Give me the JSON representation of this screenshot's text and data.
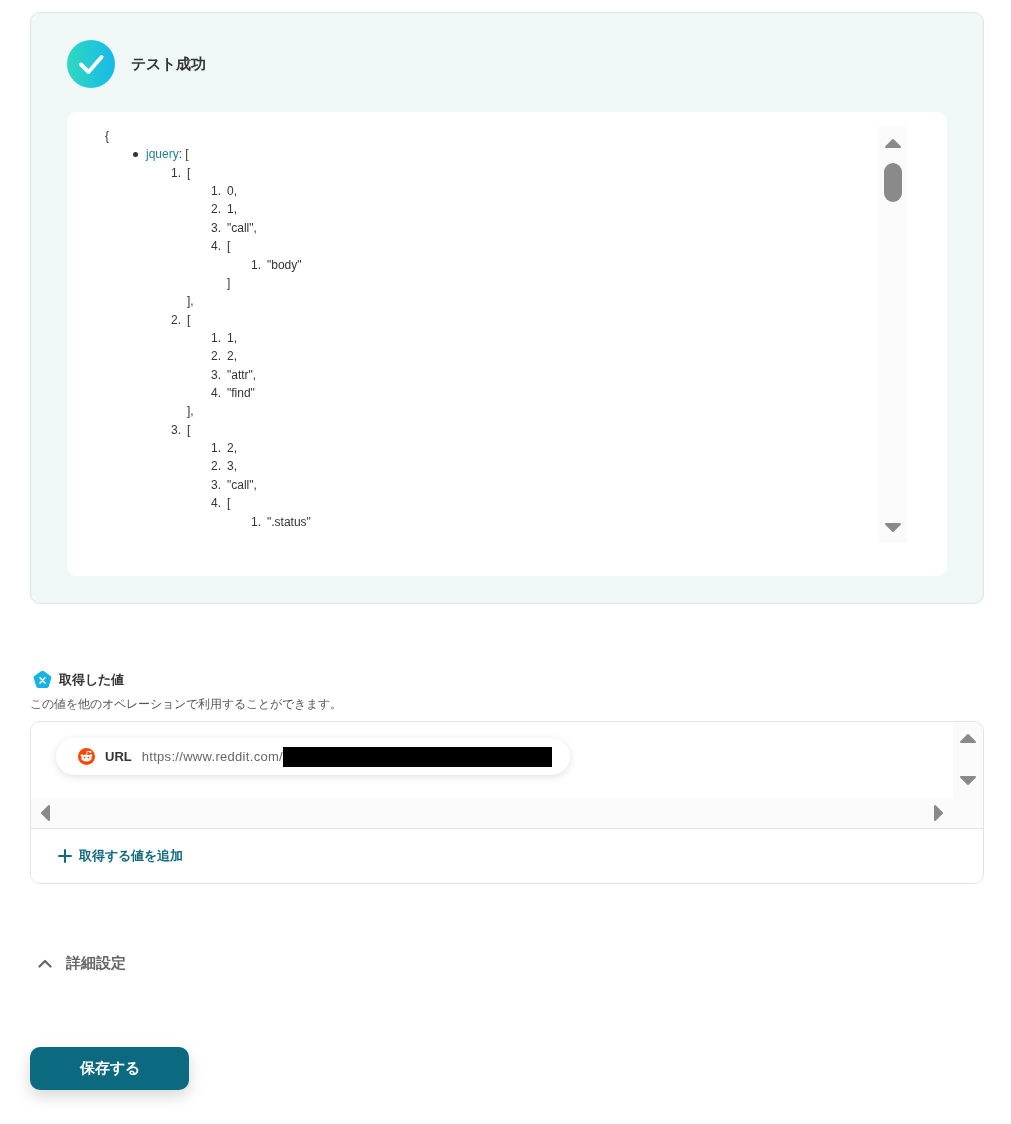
{
  "status_panel": {
    "title": "テスト成功",
    "output": {
      "open": "{",
      "properties": [
        {
          "key": "jquery",
          "after_key": ": [",
          "items": [
            {
              "marker": "1.",
              "text": "[",
              "children": [
                {
                  "marker": "1.",
                  "text": "0,"
                },
                {
                  "marker": "2.",
                  "text": "1,"
                },
                {
                  "marker": "3.",
                  "text": "\"call\","
                },
                {
                  "marker": "4.",
                  "text": "[",
                  "children": [
                    {
                      "marker": "1.",
                      "text": "\"body\""
                    }
                  ],
                  "close": "]"
                }
              ],
              "close": "],"
            },
            {
              "marker": "2.",
              "text": "[",
              "children": [
                {
                  "marker": "1.",
                  "text": "1,"
                },
                {
                  "marker": "2.",
                  "text": "2,"
                },
                {
                  "marker": "3.",
                  "text": "\"attr\","
                },
                {
                  "marker": "4.",
                  "text": "\"find\""
                }
              ],
              "close": "],"
            },
            {
              "marker": "3.",
              "text": "[",
              "children": [
                {
                  "marker": "1.",
                  "text": "2,"
                },
                {
                  "marker": "2.",
                  "text": "3,"
                },
                {
                  "marker": "3.",
                  "text": "\"call\","
                },
                {
                  "marker": "4.",
                  "text": "[",
                  "children": [
                    {
                      "marker": "1.",
                      "text": "\".status\""
                    }
                  ]
                }
              ]
            }
          ]
        }
      ]
    }
  },
  "obtained_values": {
    "title": "取得した値",
    "description": "この値を他のオペレーションで利用することができます。",
    "values": [
      {
        "label": "URL",
        "value": "https://www.reddit.com/"
      }
    ],
    "add_button": "取得する値を追加"
  },
  "advanced_settings": {
    "label": "詳細設定"
  },
  "save_button": "保存する"
}
